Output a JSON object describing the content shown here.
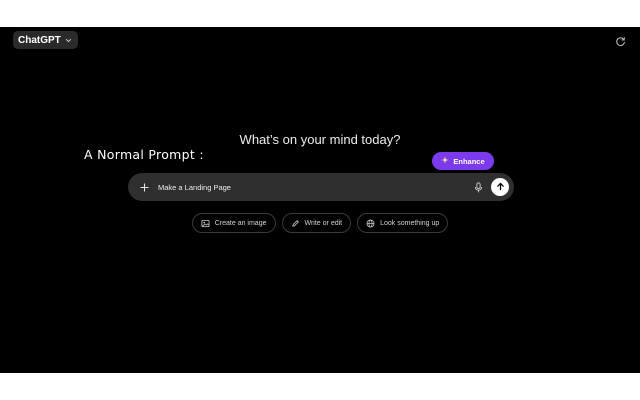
{
  "header": {
    "model_label": "ChatGPT",
    "model_chevron_icon": "chevron-down-icon",
    "refresh_icon": "refresh-icon"
  },
  "main": {
    "headline": "What’s on your mind today?",
    "annotation": "A Normal Prompt :"
  },
  "enhance": {
    "label": "Enhance",
    "icon": "sparkle-icon",
    "color": "#7c3aed"
  },
  "composer": {
    "value": "Make a Landing Page",
    "placeholder": "",
    "attach_icon": "plus-icon",
    "mic_icon": "microphone-icon",
    "send_icon": "arrow-up-icon"
  },
  "suggestions": [
    {
      "label": "Create an image",
      "icon": "image-icon"
    },
    {
      "label": "Write or edit",
      "icon": "pencil-icon"
    },
    {
      "label": "Look something up",
      "icon": "globe-icon"
    }
  ],
  "colors": {
    "background": "#000000",
    "composer": "#2f2f2f",
    "accent": "#7c3aed"
  }
}
